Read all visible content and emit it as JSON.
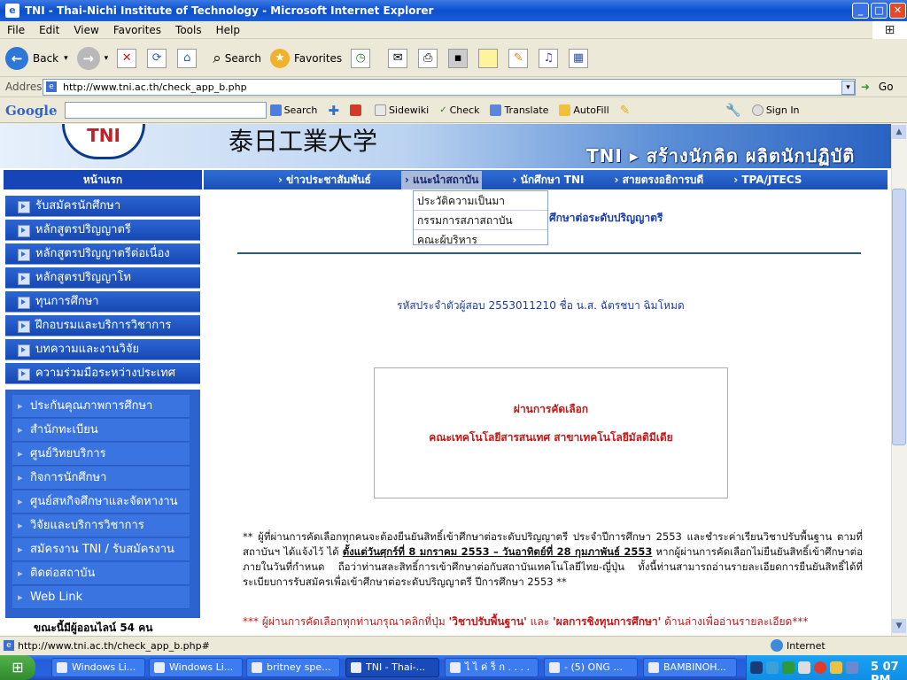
{
  "window": {
    "title": "TNI - Thai-Nichi Institute of Technology - Microsoft Internet Explorer"
  },
  "menu": [
    "File",
    "Edit",
    "View",
    "Favorites",
    "Tools",
    "Help"
  ],
  "toolbar": {
    "back": "Back",
    "search": "Search",
    "favorites": "Favorites"
  },
  "address": {
    "label": "Address",
    "url": "http://www.tni.ac.th/check_app_b.php",
    "go": "Go"
  },
  "googlebar": {
    "logo": "Google",
    "search": "Search",
    "sidewiki": "Sidewiki",
    "check": "Check",
    "translate": "Translate",
    "autofill": "AutoFill",
    "signin": "Sign In"
  },
  "page": {
    "logo_text": "TNI",
    "jp_title": "泰日工業大学",
    "slogan": "TNI ▸ สร้างนักคิด  ผลิตนักปฏิบัติ",
    "home": "หน้าแรก",
    "nav": [
      "ข่าวประชาสัมพันธ์",
      "แนะนำสถาบัน",
      "นักศึกษา TNI",
      "สายตรงอธิการบดี",
      "TPA/JTECS"
    ],
    "dropdown": [
      "ประวัติความเป็นมา",
      "กรรมการสภาสถาบัน",
      "คณะผู้บริหาร"
    ],
    "sidebar_a": [
      "รับสมัครนักศึกษา",
      "หลักสูตรปริญญาตรี",
      "หลักสูตรปริญญาตรีต่อเนื่อง",
      "หลักสูตรปริญญาโท",
      "ทุนการศึกษา",
      "ฝึกอบรมและบริการวิชาการ",
      "บทความและงานวิจัย",
      "ความร่วมมือระหว่างประเทศ"
    ],
    "sidebar_b": [
      "ประกันคุณภาพการศึกษา",
      "สำนักทะเบียน",
      "ศูนย์วิทยบริการ",
      "กิจการนักศึกษา",
      "ศูนย์สหกิจศึกษาและจัดหางาน",
      "วิจัยและบริการวิชาการ",
      "สมัครงาน TNI / รับสมัครงาน",
      "ติดต่อสถาบัน",
      "Web Link"
    ],
    "online": "ขณะนี้มีผู้ออนไลน์ 54 คน",
    "heading": "ศึกษาต่อระดับปริญญาตรี",
    "applicant": "รหัสประจำตัวผู้สอบ  2553011210     ชื่อ  น.ส. ฉัตรชบา ฉิมโหมด",
    "pass": "ผ่านการคัดเลือก",
    "faculty": "คณะเทคโนโลยีสารสนเทศ สาขาเทคโนโลยีมัลติมีเดีย",
    "notice_a": "**  ผู้ที่ผ่านการคัดเลือกทุกคนจะต้องยืนยันสิทธิ์เข้าศึกษาต่อระดับปริญญาตรี  ประจำปีการศึกษา 2553  และชำระค่าเรียนวิชาปรับพื้นฐาน ตามที่สถาบันฯ ได้แจ้งไว้ ได้ ",
    "notice_date": "ตั้งแต่วันศุกร์ที่ 8 มกราคม 2553 – วันอาทิตย์ที่ 28 กุมภาพันธ์ 2553",
    "notice_b": " หากผู้ผ่านการคัดเลือกไม่ยืนยันสิทธิ์เข้าศึกษาต่อ  ภายในวันที่กำหนด  ถือว่าท่านสละสิทธิ์การเข้าศึกษาต่อกับสถาบันเทคโนโลยีไทย-ญี่ปุ่น ทั้งนี้ท่านสามารถอ่านรายละเอียดการยืนยันสิทธิ์ได้ที่ ระเบียบการรับสมัครเพื่อเข้าศึกษาต่อระดับปริญญาตรี ปีการศึกษา 2553 **",
    "notice2_a": "*** ผู้ผ่านการคัดเลือกทุกท่านกรุณาคลิกที่ปุ่ม ",
    "notice2_link1": "'วิชาปรับพื้นฐาน'",
    "notice2_mid": " และ ",
    "notice2_link2": "'ผลการชิงทุนการศึกษา'",
    "notice2_b": " ด้านล่างเพื่ออ่านรายละเอียด***"
  },
  "status": {
    "url": "http://www.tni.ac.th/check_app_b.php#",
    "zone": "Internet"
  },
  "taskbar": {
    "tasks": [
      "Windows Li...",
      "Windows Li...",
      "britney spe...",
      "TNI - Thai-...",
      "ไ ไ ค่ ร็ ก . . . .",
      "- (5) ONG ...",
      "BAMBINOH..."
    ],
    "clock": "5 07 PM"
  }
}
